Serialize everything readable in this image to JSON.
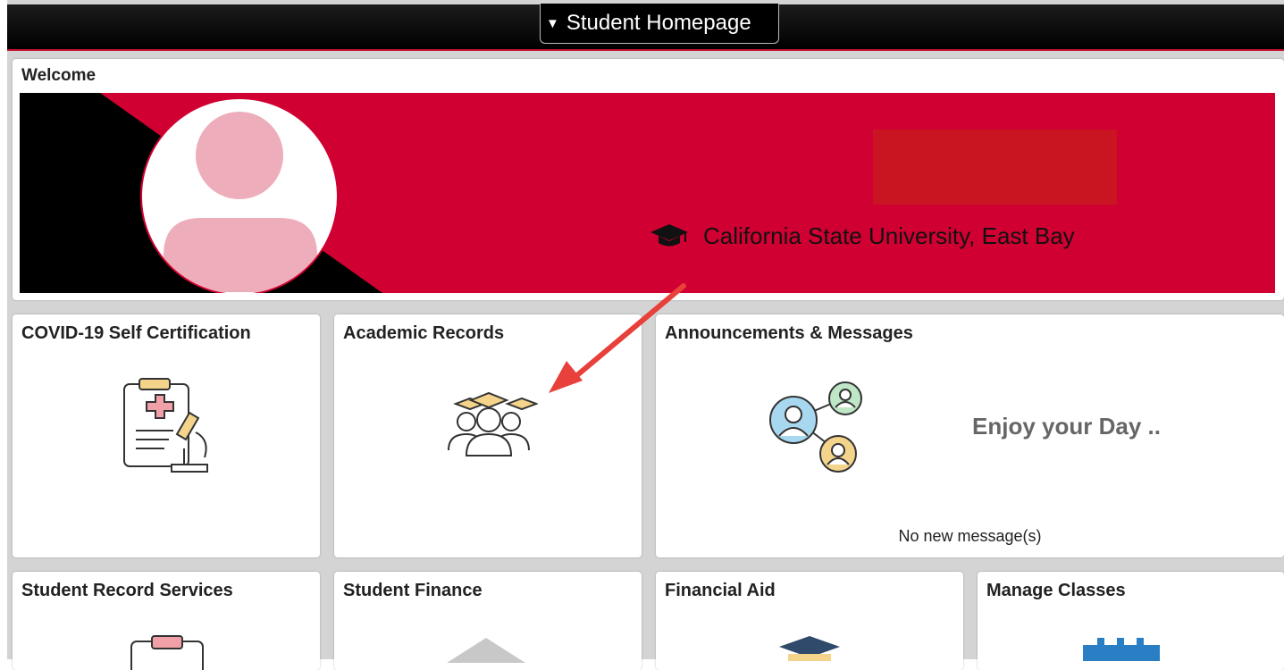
{
  "header": {
    "homepage_selector": "Student Homepage"
  },
  "welcome": {
    "title": "Welcome",
    "school": "California State University, East Bay"
  },
  "tiles": {
    "covid": {
      "title": "COVID-19 Self Certification"
    },
    "academic": {
      "title": "Academic Records"
    },
    "announcements": {
      "title": "Announcements & Messages",
      "message": "Enjoy your Day ..",
      "status": "No new message(s)"
    },
    "record_services": {
      "title": "Student Record Services"
    },
    "finance": {
      "title": "Student Finance"
    },
    "aid": {
      "title": "Financial Aid"
    },
    "classes": {
      "title": "Manage Classes"
    }
  },
  "colors": {
    "brand_red": "#d10032",
    "header_black": "#000000",
    "annotation_arrow": "#e8403a"
  },
  "icons": [
    "graduation-cap-icon",
    "clipboard-microscope-icon",
    "graduates-icon",
    "people-network-icon",
    "clipboard-icon",
    "house-icon",
    "graduation-cap-icon",
    "calendar-icon",
    "caret-down-icon"
  ]
}
